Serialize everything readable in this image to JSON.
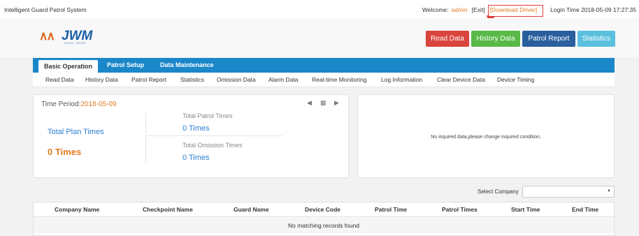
{
  "topbar": {
    "app_title": "Intelligent Guard Patrol System",
    "welcome_label": "Welcome:",
    "user": "admin",
    "exit_label": "[Exit]",
    "download_label": "[Download Driver]",
    "login_time": "Login Time 2018-05-09 17:27:35"
  },
  "logo": {
    "text": "JWM",
    "sub": "HIGH TECH"
  },
  "actions": {
    "read": "Read Data",
    "history": "History Data",
    "patrol": "Patrol Report",
    "statistics": "Statistics"
  },
  "main_tabs": [
    "Basic Operation",
    "Patrol Setup",
    "Data Maintenance"
  ],
  "sub_tabs": [
    "Read Data",
    "History Data",
    "Patrol Report",
    "Statistics",
    "Omission Data",
    "Alarm Data",
    "Real-time Monitoring",
    "Log Information",
    "Clear Device Data",
    "Device Timing"
  ],
  "summary": {
    "period_label": "Time Period:",
    "period_date": "2018-05-09",
    "plan_label": "Total Plan Times",
    "plan_value": "0 Times",
    "patrol_label": "Total Patrol Times",
    "patrol_value": "0 Times",
    "omission_label": "Total Omission Times",
    "omission_value": "0 Times"
  },
  "chart_panel": {
    "empty_message": "No inquired data,please change inquired condition."
  },
  "filter": {
    "company_label": "Select Company",
    "company_value": ""
  },
  "table": {
    "columns": [
      "Company Name",
      "Checkpoint Name",
      "Guard Name",
      "Device Code",
      "Patrol Time",
      "Patrol Times",
      "Start Time",
      "End Time"
    ],
    "empty_message": "No matching records found"
  },
  "colors": {
    "accent": "#1a87c9",
    "read": "#d9453d",
    "history": "#58b947",
    "patrol": "#2a5f9e",
    "statistics": "#5bc0de",
    "highlight": "#e07c22"
  }
}
